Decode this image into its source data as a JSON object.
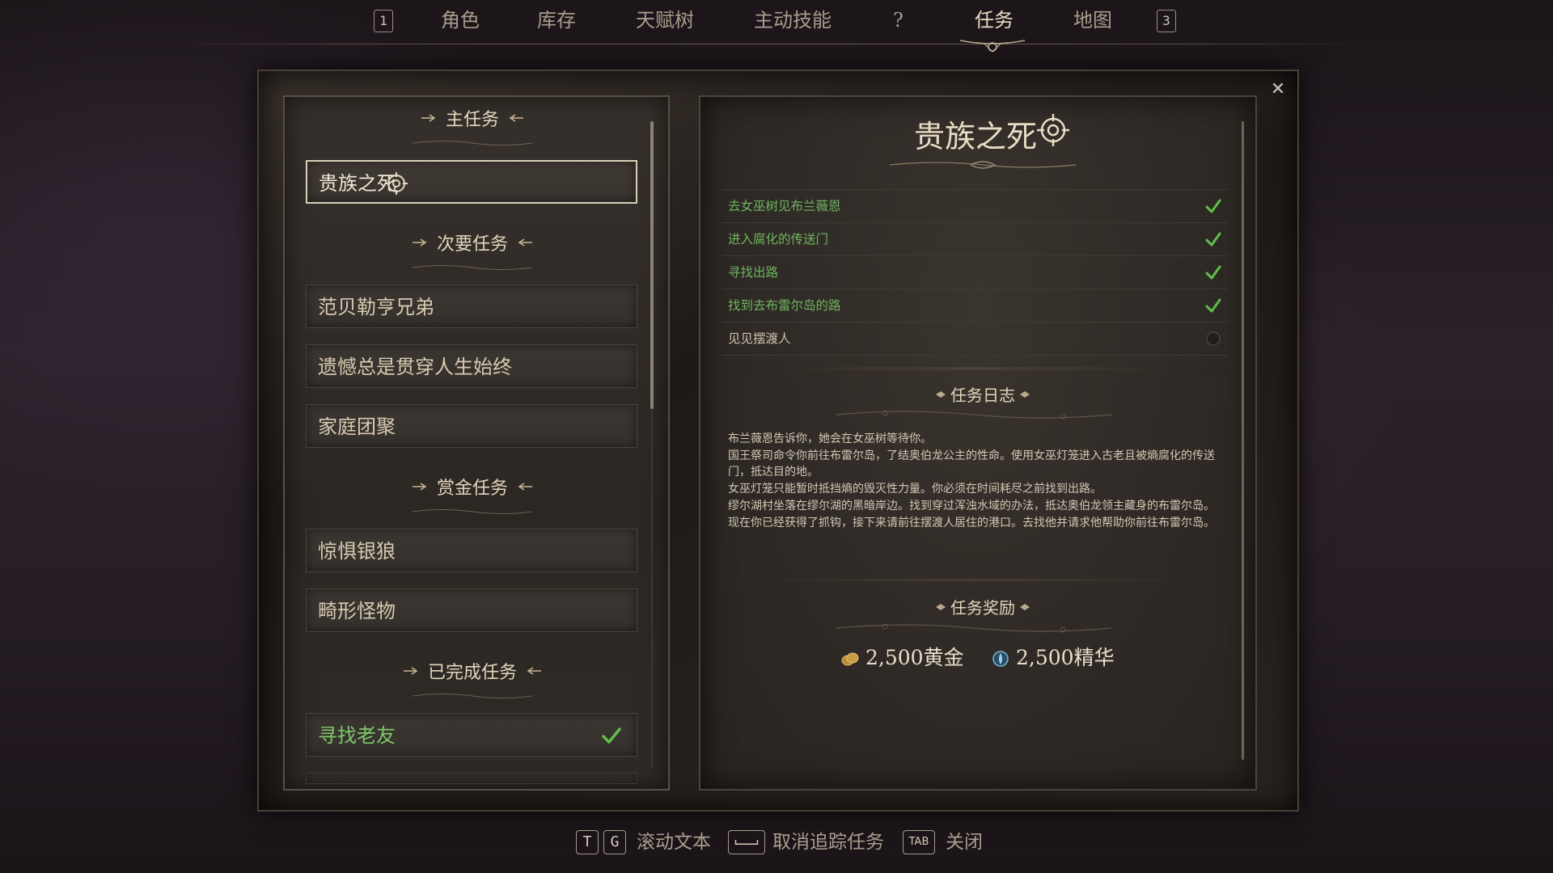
{
  "nav": {
    "left_key": "1",
    "right_key": "3",
    "tabs": [
      "角色",
      "库存",
      "天赋树",
      "主动技能",
      "?",
      "任务",
      "地图"
    ],
    "active_tab": "任务"
  },
  "left": {
    "main_header": "主任务",
    "main_quests": [
      {
        "label": "贵族之死",
        "selected": true,
        "tracked": true
      }
    ],
    "side_header": "次要任务",
    "side_quests": [
      "范贝勒亨兄弟",
      "遗憾总是贯穿人生始终",
      "家庭团聚"
    ],
    "bounty_header": "赏金任务",
    "bounty_quests": [
      "惊惧银狼",
      "畸形怪物"
    ],
    "completed_header": "已完成任务",
    "completed_quests": [
      {
        "label": "寻找老友",
        "done": true
      }
    ]
  },
  "detail": {
    "title": "贵族之死",
    "objectives": [
      {
        "text": "去女巫树见布兰薇恩",
        "done": true
      },
      {
        "text": "进入腐化的传送门",
        "done": true
      },
      {
        "text": "寻找出路",
        "done": true
      },
      {
        "text": "找到去布雷尔岛的路",
        "done": true
      },
      {
        "text": "见见摆渡人",
        "done": false
      }
    ],
    "journal_header": "任务日志",
    "journal": [
      "布兰薇恩告诉你，她会在女巫树等待你。",
      "国王祭司命令你前往布雷尔岛，了结奥伯龙公主的性命。使用女巫灯笼进入古老且被熵腐化的传送门，抵达目的地。",
      "女巫灯笼只能暂时抵挡熵的毁灭性力量。你必须在时间耗尽之前找到出路。",
      "缪尔湖村坐落在缪尔湖的黑暗岸边。找到穿过浑浊水域的办法，抵达奥伯龙领主藏身的布雷尔岛。",
      "现在你已经获得了抓钩，接下来请前往摆渡人居住的港口。去找他并请求他帮助你前往布雷尔岛。"
    ],
    "rewards_header": "任务奖励",
    "reward_gold": "2,500黄金",
    "reward_essence": "2,500精华"
  },
  "hints": {
    "key_t": "T",
    "key_g": "G",
    "scroll_label": "滚动文本",
    "untrack_label": "取消追踪任务",
    "key_tab": "TAB",
    "close_label": "关闭"
  },
  "colors": {
    "completed_green": "#6fb460",
    "check_green": "#5fbf4a",
    "text_light": "#e3d6bd"
  },
  "icons": [
    "target-icon",
    "check-icon",
    "close-icon",
    "gold-icon",
    "essence-icon",
    "arrow-left-icon",
    "arrow-right-icon",
    "space-key-icon"
  ]
}
